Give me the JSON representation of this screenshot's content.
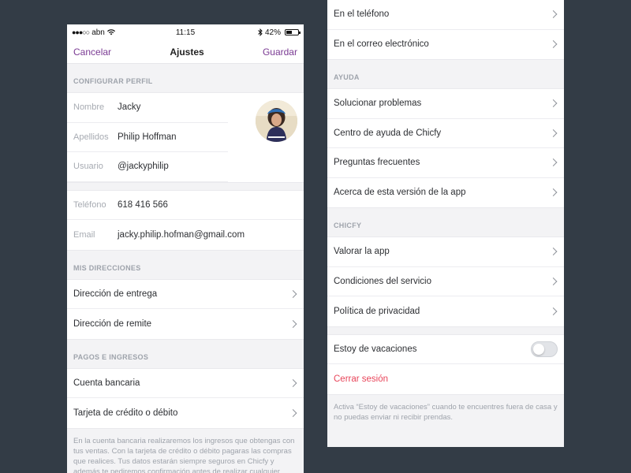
{
  "status_bar": {
    "carrier": "abn",
    "time": "11:15",
    "battery": "42%"
  },
  "nav": {
    "cancel": "Cancelar",
    "title": "Ajustes",
    "save": "Guardar"
  },
  "profile": {
    "header": "CONFIGURAR PERFIL",
    "fields": [
      {
        "label": "Nombre",
        "value": "Jacky"
      },
      {
        "label": "Apellidos",
        "value": "Philip Hoffman"
      },
      {
        "label": "Usuario",
        "value": "@jackyphilip"
      }
    ]
  },
  "contact": {
    "fields": [
      {
        "label": "Teléfono",
        "value": "618 416 566"
      },
      {
        "label": "Email",
        "value": "jacky.philip.hofman@gmail.com"
      }
    ]
  },
  "addresses": {
    "header": "MIS DIRECCIONES",
    "items": [
      "Dirección de entrega",
      "Dirección de remite"
    ]
  },
  "payments": {
    "header": "PAGOS E INGRESOS",
    "items": [
      "Cuenta bancaria",
      "Tarjeta de crédito o débito"
    ],
    "note": "En la cuenta bancaria realizaremos los ingresos que obtengas con tus ventas. Con la tarjeta de crédito o débito pagaras las compras que realices. Tus datos estarán siempre seguros en Chicfy y además te pediremos confirmación antes de realizar cualquier"
  },
  "notifications": {
    "items": [
      "En el teléfono",
      "En el correo electrónico"
    ]
  },
  "help": {
    "header": "AYUDA",
    "items": [
      "Solucionar problemas",
      "Centro de ayuda de Chicfy",
      "Preguntas frecuentes",
      "Acerca de esta versión de la app"
    ]
  },
  "chicfy": {
    "header": "CHICFY",
    "items": [
      "Valorar la app",
      "Condiciones del servicio",
      "Política de privacidad"
    ]
  },
  "vacation": {
    "label": "Estoy de vacaciones",
    "enabled": false,
    "logout": "Cerrar sesión",
    "note": "Activa “Estoy de vacaciones” cuando te encuentres fuera de casa y no puedas enviar ni recibir prendas."
  },
  "colors": {
    "accent": "#7a3a93",
    "danger": "#e8455a",
    "background": "#333c46"
  }
}
